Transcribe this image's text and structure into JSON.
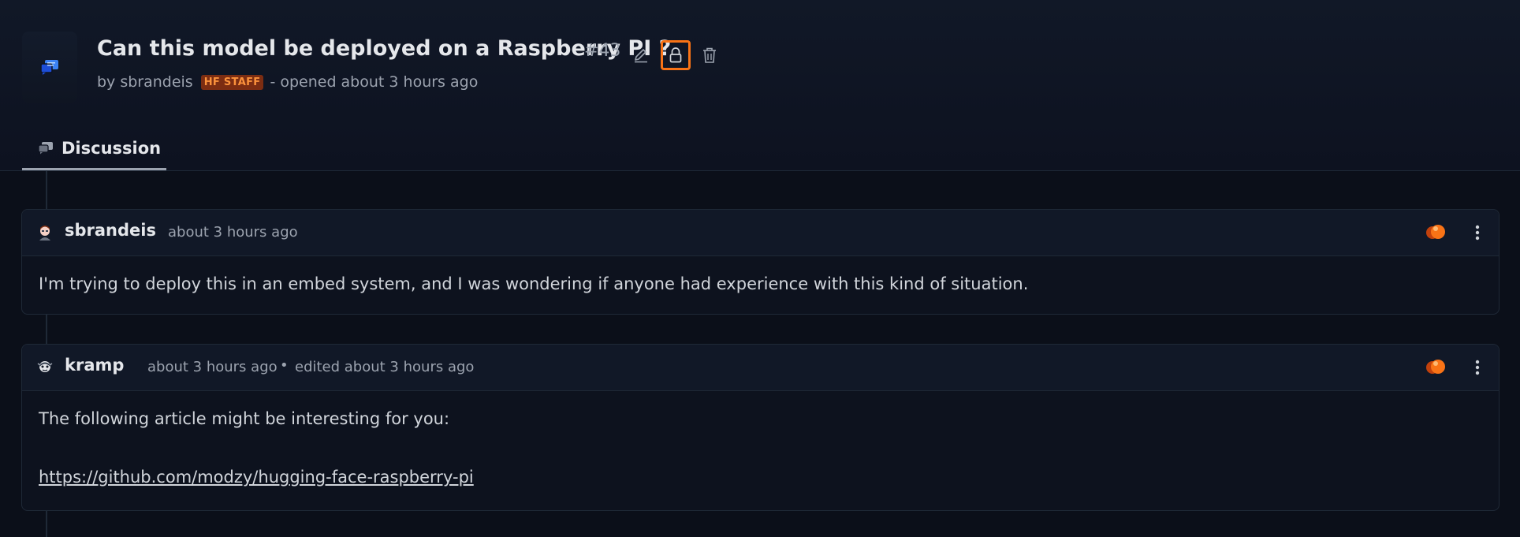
{
  "discussion": {
    "title": "Can this model be deployed on a Raspberry PI ?",
    "number": "#43",
    "by_prefix": "by",
    "author": "sbrandeis",
    "author_badge": "HF STAFF",
    "opened_text": "- opened about 3 hours ago"
  },
  "tabs": [
    {
      "label": "Discussion",
      "icon": "discussion-icon"
    }
  ],
  "comments": [
    {
      "author": "sbrandeis",
      "time": "about 3 hours ago",
      "body": "I'm trying to deploy this in an embed system, and I was wondering if anyone had experience with this kind of situation."
    },
    {
      "author": "kramp",
      "time": "about 3 hours ago",
      "separator": "•",
      "edited": "edited about 3 hours ago",
      "body_line1": "The following article might be interesting for you:",
      "link": "https://github.com/modzy/hugging-face-raspberry-pi"
    }
  ],
  "colors": {
    "accent": "#f97316",
    "background": "#0b0f19",
    "card": "#111827"
  }
}
